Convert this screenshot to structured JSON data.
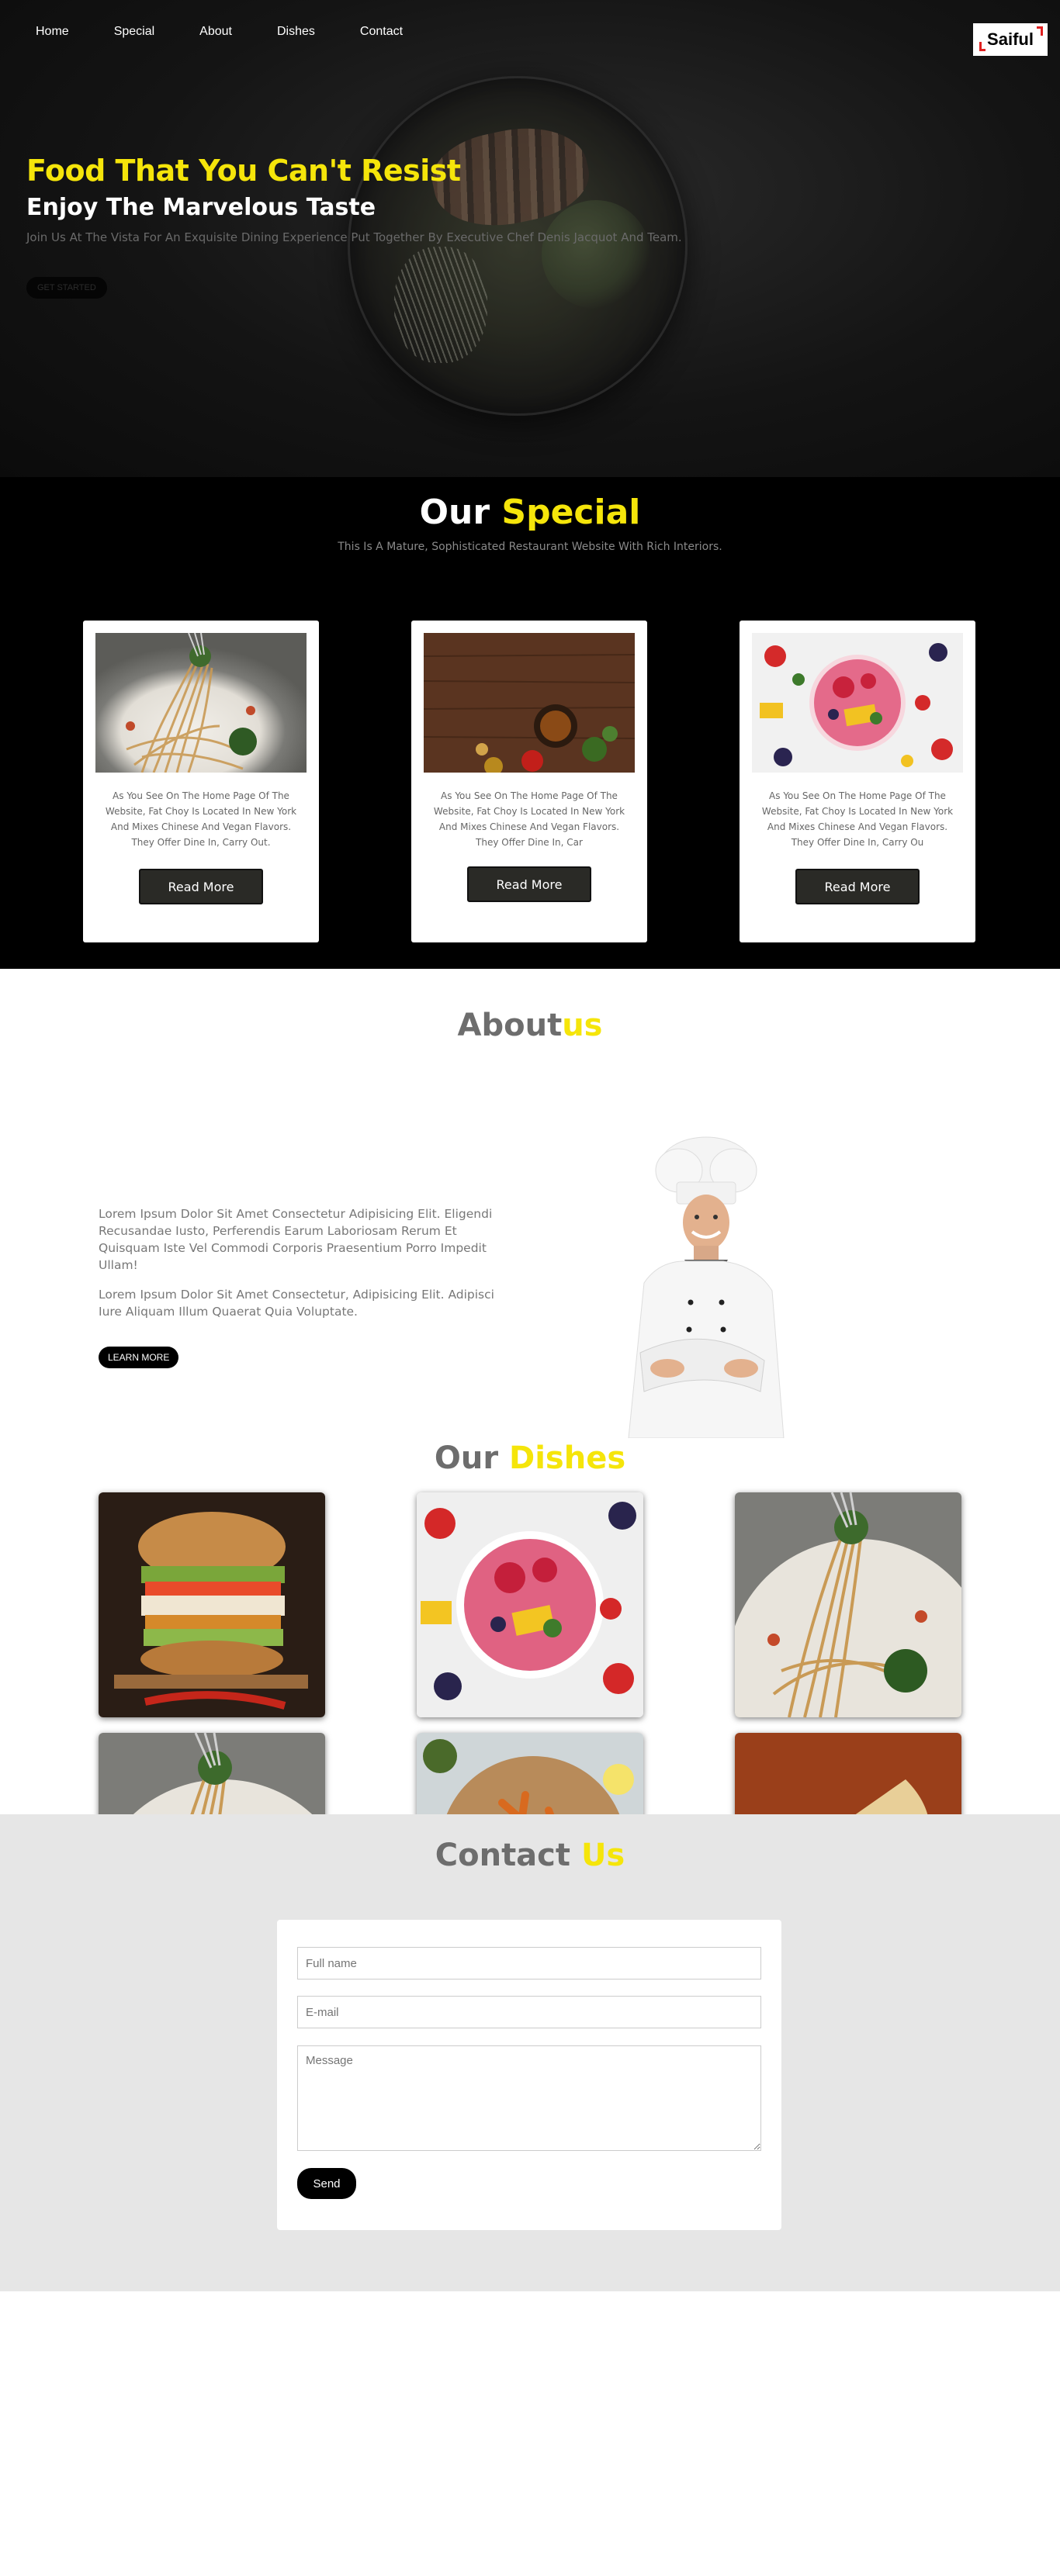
{
  "nav": {
    "items": [
      "Home",
      "Special",
      "About",
      "Dishes",
      "Contact"
    ]
  },
  "logo": {
    "text": "Saiful"
  },
  "hero": {
    "title": "Food That You Can't Resist",
    "subtitle": "Enjoy The Marvelous Taste",
    "description": "Join Us At The Vista For An Exquisite Dining Experience Put Together By Executive Chef Denis Jacquot And Team.",
    "button": "GET STARTED"
  },
  "special": {
    "title_part1": "Our ",
    "title_part2": "Special",
    "subtitle": "This Is A Mature, Sophisticated Restaurant Website With Rich Interiors.",
    "cards": [
      {
        "image": "spaghetti",
        "text": "As You See On The Home Page Of The Website, Fat Choy Is Located In New York And Mixes Chinese And Vegan Flavors. They Offer Dine In, Carry Out.",
        "button": "Read More"
      },
      {
        "image": "wood-table-ingredients",
        "text": "As You See On The Home Page Of The Website, Fat Choy Is Located In New York And Mixes Chinese And Vegan Flavors. They Offer Dine In, Car",
        "button": "Read More"
      },
      {
        "image": "fruit-bowl",
        "text": "As You See On The Home Page Of The Website, Fat Choy Is Located In New York And Mixes Chinese And Vegan Flavors. They Offer Dine In, Carry Ou",
        "button": "Read More"
      }
    ]
  },
  "about": {
    "title_part1": "About",
    "title_part2": "us",
    "paragraph1": "Lorem Ipsum Dolor Sit Amet Consectetur Adipisicing Elit. Eligendi Recusandae Iusto, Perferendis Earum Laboriosam Rerum Et Quisquam Iste Vel Commodi Corporis Praesentium Porro Impedit Ullam!",
    "paragraph2": "Lorem Ipsum Dolor Sit Amet Consectetur, Adipisicing Elit. Adipisci Iure Aliquam Illum Quaerat Quia Voluptate.",
    "button": "LEARN MORE"
  },
  "dishes": {
    "title_part1": "Our ",
    "title_part2": "Dishes",
    "items": [
      "burger",
      "fruit-bowl",
      "spaghetti",
      "spaghetti",
      "sweet-potato-fries",
      "burrito"
    ]
  },
  "contact": {
    "title_part1": "Contact ",
    "title_part2": "Us",
    "name_placeholder": "Full name",
    "email_placeholder": "E-mail",
    "message_placeholder": "Message",
    "send": "Send"
  },
  "colors": {
    "accent": "#f5e50a",
    "dark": "#000000",
    "button_dark": "#2a2a26",
    "contact_bg": "#e6e6e6"
  }
}
